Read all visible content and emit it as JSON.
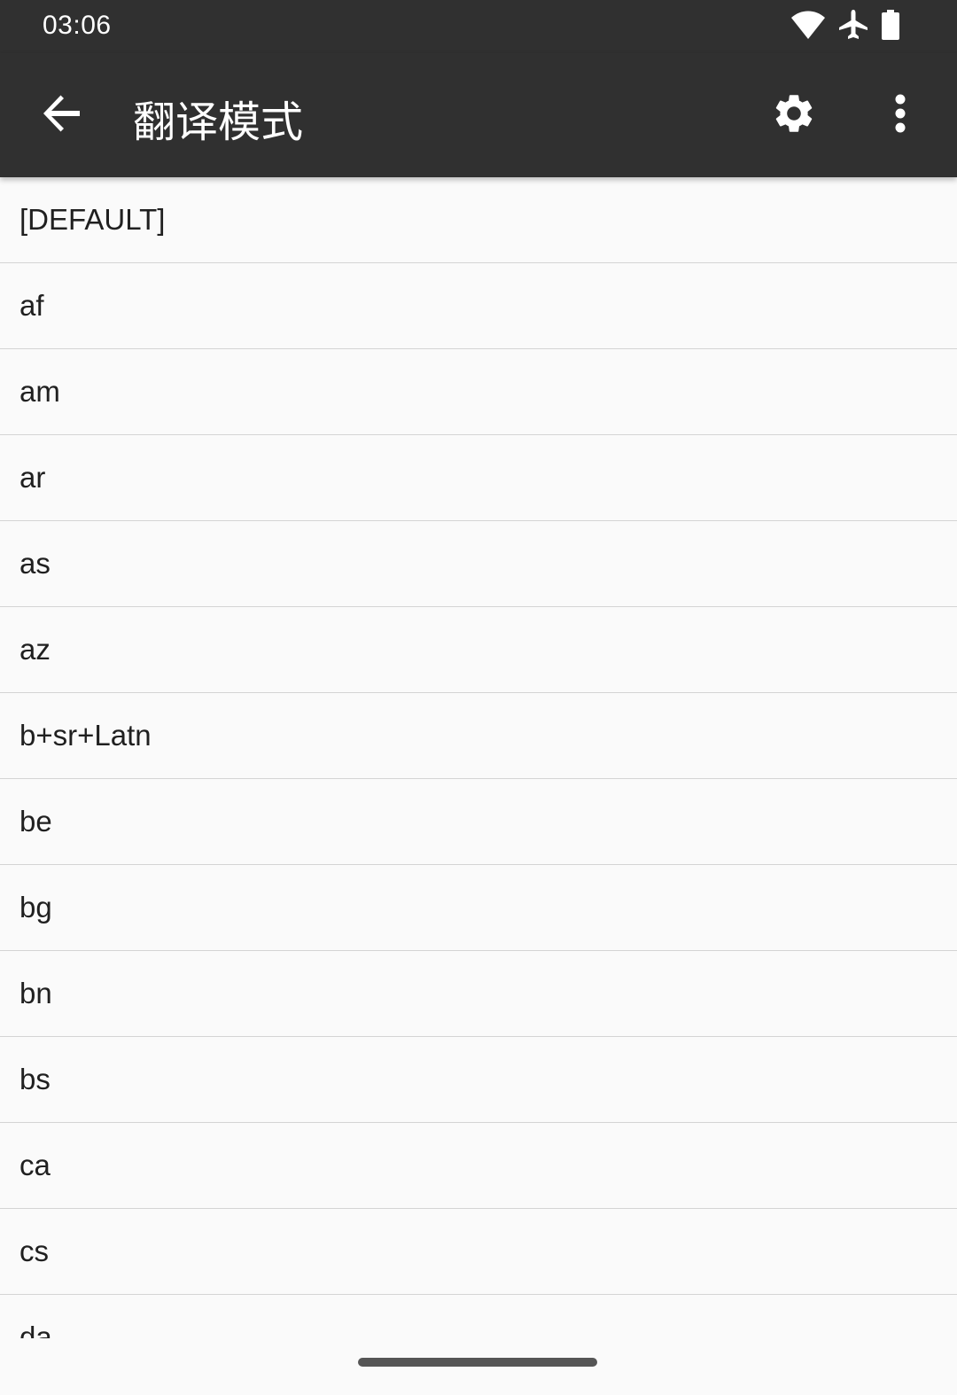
{
  "status_bar": {
    "time": "03:06",
    "icons": [
      "wifi-icon",
      "airplane-icon",
      "battery-icon"
    ]
  },
  "toolbar": {
    "title": "翻译模式",
    "back_icon": "arrow-back-icon",
    "settings_icon": "gear-icon",
    "overflow_icon": "more-vert-icon"
  },
  "list": {
    "items": [
      "[DEFAULT]",
      "af",
      "am",
      "ar",
      "as",
      "az",
      "b+sr+Latn",
      "be",
      "bg",
      "bn",
      "bs",
      "ca",
      "cs",
      "da"
    ]
  },
  "colors": {
    "app_bar": "#303030",
    "background": "#fafafa",
    "divider": "#d4d4d4",
    "text": "#202020"
  }
}
